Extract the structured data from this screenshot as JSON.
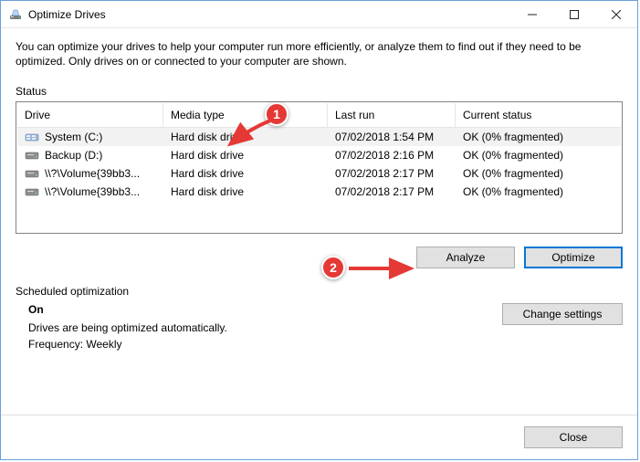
{
  "window": {
    "title": "Optimize Drives"
  },
  "intro": "You can optimize your drives to help your computer run more efficiently, or analyze them to find out if they need to be optimized. Only drives on or connected to your computer are shown.",
  "status_label": "Status",
  "columns": {
    "drive": "Drive",
    "media": "Media type",
    "last": "Last run",
    "status": "Current status"
  },
  "drives": [
    {
      "icon": "system",
      "name": "System (C:)",
      "media": "Hard disk drive",
      "last": "07/02/2018 1:54 PM",
      "status": "OK (0% fragmented)",
      "selected": true
    },
    {
      "icon": "hdd",
      "name": "Backup (D:)",
      "media": "Hard disk drive",
      "last": "07/02/2018 2:16 PM",
      "status": "OK (0% fragmented)",
      "selected": false
    },
    {
      "icon": "hdd",
      "name": "\\\\?\\Volume{39bb3...",
      "media": "Hard disk drive",
      "last": "07/02/2018 2:17 PM",
      "status": "OK (0% fragmented)",
      "selected": false
    },
    {
      "icon": "hdd",
      "name": "\\\\?\\Volume{39bb3...",
      "media": "Hard disk drive",
      "last": "07/02/2018 2:17 PM",
      "status": "OK (0% fragmented)",
      "selected": false
    }
  ],
  "buttons": {
    "analyze": "Analyze",
    "optimize": "Optimize",
    "change": "Change settings",
    "close": "Close"
  },
  "scheduled": {
    "label": "Scheduled optimization",
    "on": "On",
    "desc": "Drives are being optimized automatically.",
    "freq": "Frequency: Weekly"
  },
  "annotations": {
    "badge1": "1",
    "badge2": "2"
  }
}
